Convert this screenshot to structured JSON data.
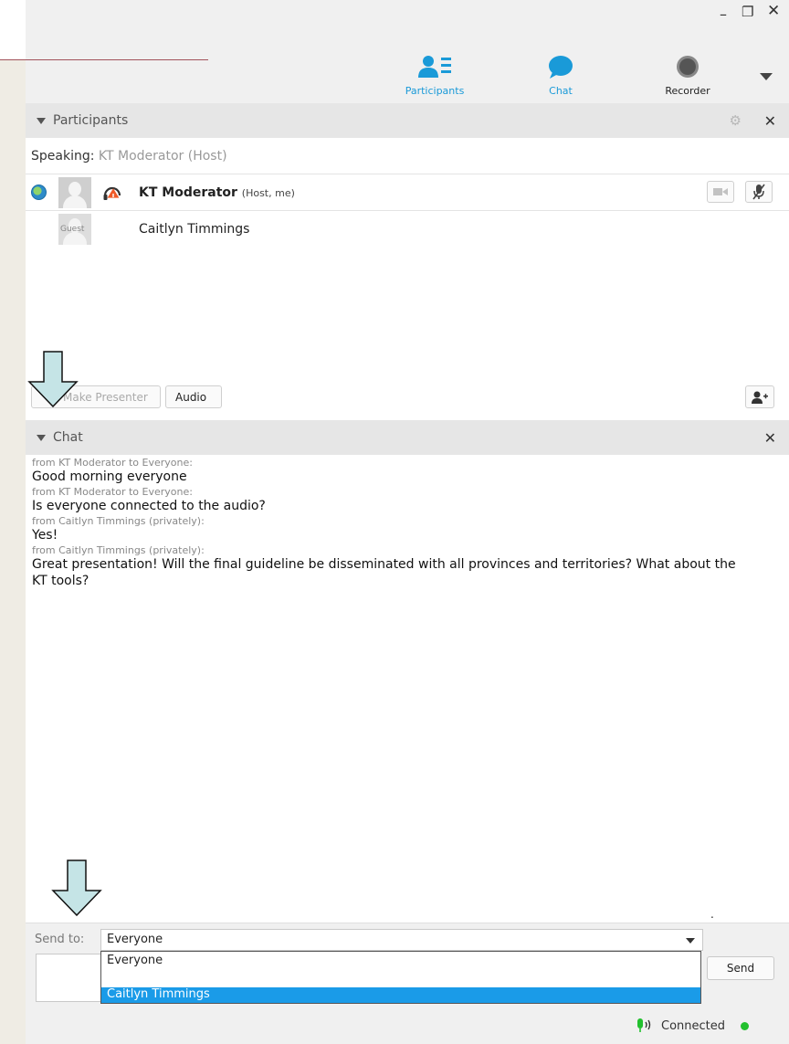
{
  "window": {
    "minimize_glyph": "–",
    "maximize_glyph": "❐",
    "close_glyph": "✕"
  },
  "toolbar": {
    "participants_label": "Participants",
    "chat_label": "Chat",
    "recorder_label": "Recorder"
  },
  "participants_panel": {
    "title": "Participants",
    "speaking_label": "Speaking:",
    "speaking_name": "KT Moderator (Host)",
    "rows": [
      {
        "name": "KT Moderator",
        "role": "(Host, me)"
      },
      {
        "name": "Caitlyn Timmings",
        "avatar_tag": "Guest"
      }
    ],
    "make_presenter_label": "Make Presenter",
    "audio_label": "Audio"
  },
  "chat_panel": {
    "title": "Chat",
    "messages": [
      {
        "meta": "from KT Moderator to Everyone:",
        "text": "Good morning everyone"
      },
      {
        "meta": "from KT Moderator to Everyone:",
        "text": "Is everyone connected to the audio?"
      },
      {
        "meta": "from Caitlyn Timmings (privately):",
        "text": "Yes!"
      },
      {
        "meta": "from Caitlyn Timmings (privately):",
        "text": "Great presentation! Will the final guideline be disseminated with all provinces and territories? What about the KT tools?"
      }
    ],
    "trailing_dot": "."
  },
  "send": {
    "label": "Send to:",
    "selected": "Everyone",
    "options": [
      "Everyone",
      "Caitlyn Timmings"
    ],
    "button_label": "Send"
  },
  "status": {
    "text": "Connected"
  },
  "colors": {
    "accent": "#1a9ad8",
    "selection": "#1a9be8",
    "connected": "#22c02e",
    "warning": "#f05a28",
    "arrow_fill": "#c5e4e6"
  }
}
